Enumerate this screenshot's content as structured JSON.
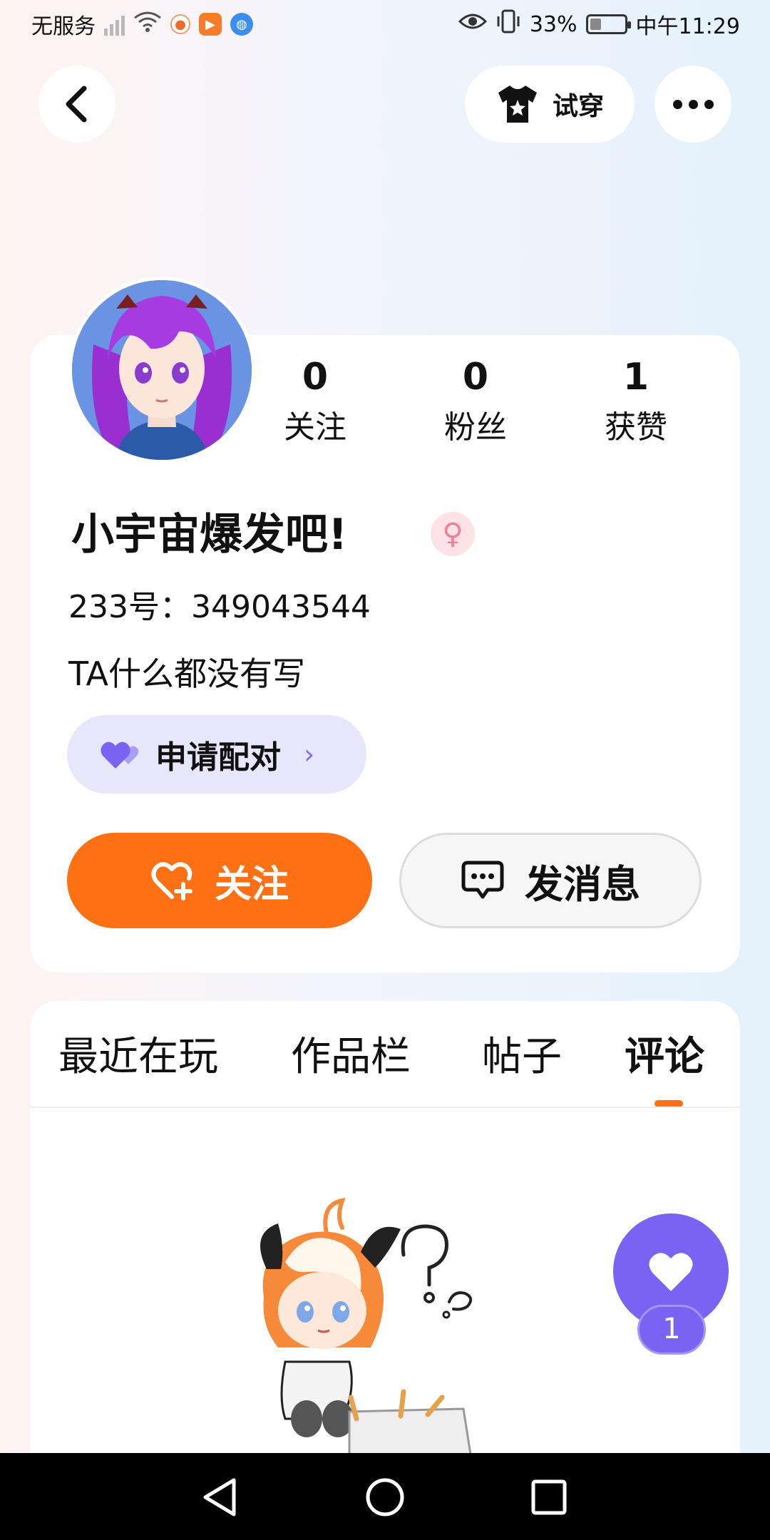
{
  "status_bar": {
    "carrier": "无服务",
    "battery_percent": "33%",
    "battery_level": 0.33,
    "time": "中午11:29",
    "icons": [
      "signal-icon",
      "wifi-icon",
      "app-notification-icon",
      "video-app-icon",
      "browser-app-icon",
      "eye-comfort-icon",
      "vibrate-icon",
      "battery-icon"
    ]
  },
  "header": {
    "back_icon": "chevron-left-icon",
    "tryon_label": "试穿",
    "tryon_icon": "tshirt-star-icon",
    "more_icon": "more-dots-icon"
  },
  "profile": {
    "stats": [
      {
        "value": "0",
        "label": "关注"
      },
      {
        "value": "0",
        "label": "粉丝"
      },
      {
        "value": "1",
        "label": "获赞"
      }
    ],
    "nickname": "小宇宙爆发吧!",
    "gender": "female",
    "uid_line": "233号：349043544",
    "bio": "TA什么都没有写",
    "pair_button": "申请配对",
    "follow_button": "关注",
    "message_button": "发消息"
  },
  "tabs": [
    {
      "label": "最近在玩",
      "active": false
    },
    {
      "label": "作品栏",
      "active": false
    },
    {
      "label": "帖子",
      "active": false
    },
    {
      "label": "评论",
      "active": true
    }
  ],
  "like_fab": {
    "count": "1"
  },
  "colors": {
    "accent_orange": "#fd7114",
    "accent_purple": "#7a62f2",
    "pair_bg": "#e7e6fb",
    "gender_pink": "#f27d96"
  },
  "nav_bar": {
    "buttons": [
      "back-triangle-icon",
      "home-circle-icon",
      "recents-square-icon"
    ]
  }
}
